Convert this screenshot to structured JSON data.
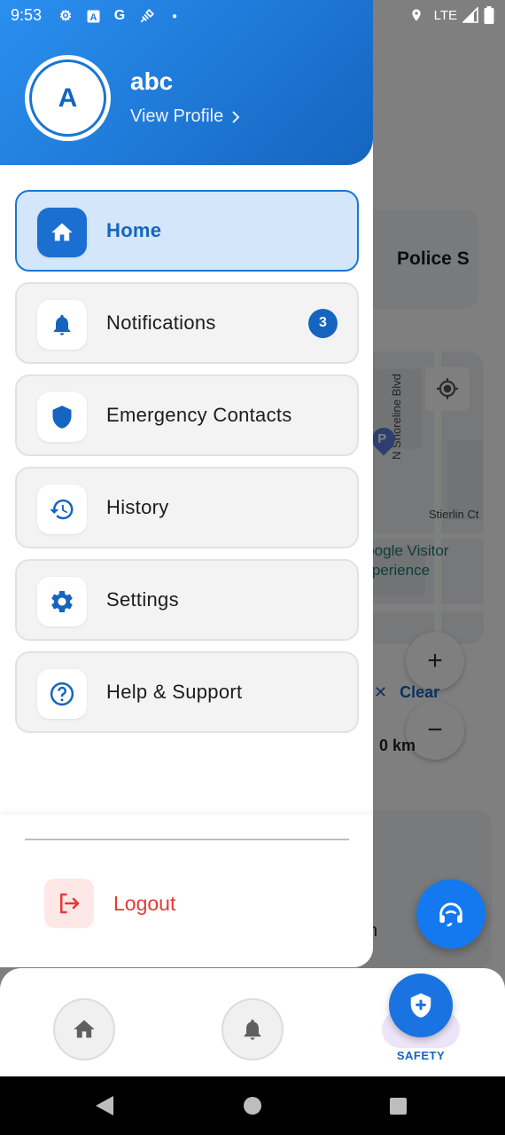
{
  "status_bar": {
    "time": "9:53",
    "network": "LTE",
    "icons_left": [
      "settings-icon",
      "a-badge-icon",
      "g-icon",
      "satellite-icon",
      "dot-icon"
    ],
    "icons_right": [
      "location-icon",
      "signal-icon",
      "battery-icon"
    ]
  },
  "drawer": {
    "avatar_letter": "A",
    "user_name": "abc",
    "view_profile": "View Profile",
    "items": [
      {
        "label": "Home",
        "icon": "home-icon",
        "active": true
      },
      {
        "label": "Notifications",
        "icon": "bell-icon",
        "badge": "3"
      },
      {
        "label": "Emergency Contacts",
        "icon": "shield-icon"
      },
      {
        "label": "History",
        "icon": "history-icon"
      },
      {
        "label": "Settings",
        "icon": "gear-icon"
      },
      {
        "label": "Help & Support",
        "icon": "help-icon"
      }
    ],
    "logout_label": "Logout"
  },
  "background": {
    "police_label": "Police S",
    "street_1": "N Shoreline Blvd",
    "street_2": "Stierlin Ct",
    "poi_line1": "Google Visitor",
    "poi_line2": "Experience",
    "pin_letter": "P",
    "zoom_in": "+",
    "zoom_out": "−",
    "clear_label": "Clear",
    "distance": "0 km",
    "card_fragment": "n"
  },
  "bottom_nav": {
    "safety_label": "SAFETY"
  },
  "colors": {
    "primary": "#1565c0",
    "primary_light": "#2a8ff0",
    "active_bg": "#d4e6f9",
    "logout_red": "#e53935"
  }
}
